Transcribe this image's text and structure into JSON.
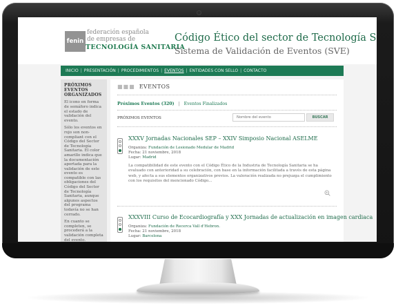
{
  "header": {
    "logo_mark": "fenin",
    "logo_line1": "federación española",
    "logo_line2": "de empresas de",
    "logo_line3": "TECNOLOGÍA SANITARIA",
    "title": "Código Ético del sector de Tecnología Sanitaria",
    "subtitle": "Sistema de Validación de Eventos (SVE)"
  },
  "nav": {
    "items": [
      "INICIO",
      "PRESENTACIÓN",
      "PROCEDIMIENTOS",
      "EVENTOS",
      "ENTIDADES CON SELLO",
      "CONTACTO"
    ],
    "active": "EVENTOS"
  },
  "sidebar": {
    "title": "PRÓXIMOS EVENTOS ORGANIZADOS",
    "paragraphs": [
      "El icono en forma de semáforo indica el estado de validación del evento.",
      "Sólo los eventos en rojo son non-compliant con el Código del Sector de Tecnología Sanitaria. El color amarillo indica que la documentación aportada para la validación de este evento es compatible con las obligaciones del Código del Sector de Tecnología Sanitaria, aunque algunos aspectos del programa todavía no se han cerrado.",
      "En cuanto se completen, se procederá a la validación completa del evento."
    ]
  },
  "main": {
    "section_dots": "■■■",
    "section_title": "EVENTOS",
    "tab_active": "Próximos Eventos (320)",
    "tab_separator": "|",
    "tab_inactive": "Eventos Finalizados",
    "list_label": "PRÓXIMOS EVENTOS",
    "search_placeholder": "Nombre del evento",
    "search_button": "BUSCAR",
    "events": [
      {
        "title": "XXXV Jornadas Nacionales SEP – XXIV Simposio Nacional ASELME",
        "organiza_label": "Organiza:",
        "organiza": "Fundación de Lesionado Medular de Madrid",
        "fecha_label": "Fecha:",
        "fecha": "21 noviembre, 2018",
        "lugar_label": "Lugar:",
        "lugar": "Madrid",
        "description": "La compatibilidad de este evento con el Código Ético de la Industria de Tecnología Sanitaria se ha evaluado con anterioridad a su celebración, con base en la información facilitada a través de esta página web, y afecta a sus elementos organizativos previos. La valoración realizada no prejuzga el cumplimiento con los requisitos del mencionado Código..."
      },
      {
        "title": "XXXVIII Curso de Ecocardiografía y XXX Jornadas de actualización en imagen cardiaca",
        "organiza_label": "Organiza:",
        "organiza": "Fundación de Recerca Vall d'Hebron.",
        "fecha_label": "Fecha:",
        "fecha": "21 noviembre, 2018",
        "lugar_label": "Lugar:",
        "lugar": "Barcelona"
      }
    ]
  },
  "colors": {
    "brand_green": "#1d7a55",
    "logo_grey": "#939393",
    "sidebar_bg": "#e2e2e2",
    "traffic_green": "#1d8a55"
  }
}
